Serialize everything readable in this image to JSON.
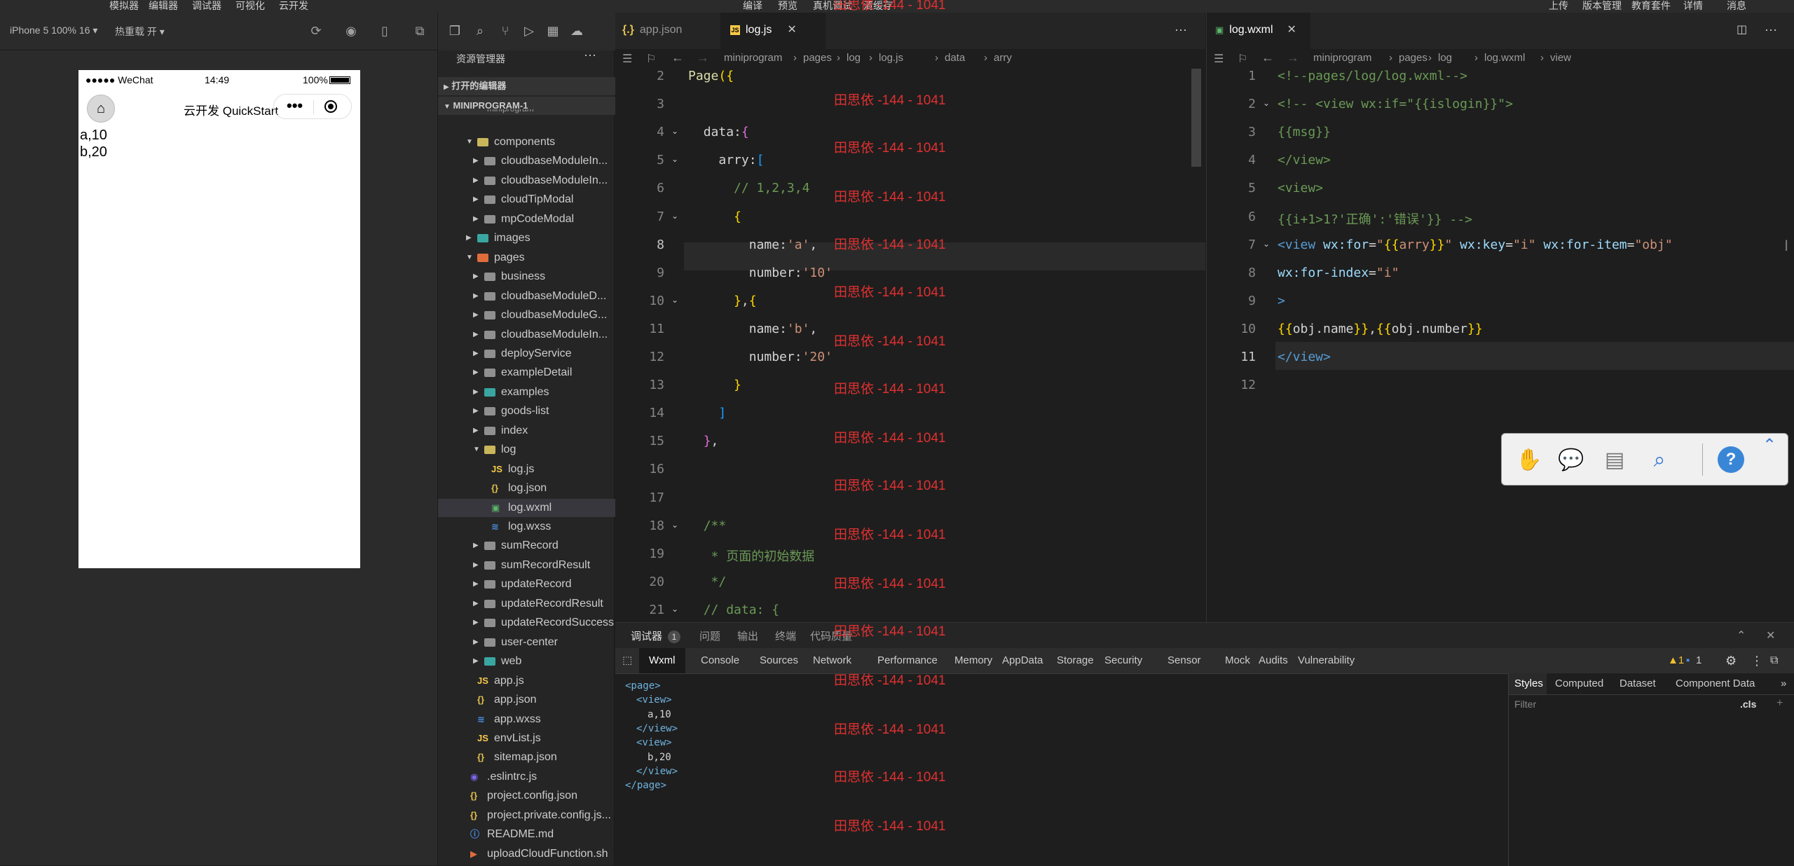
{
  "menubar": {
    "items": [
      "模拟器",
      "编辑器",
      "调试器",
      "可视化",
      "云开发",
      "编译",
      "预览",
      "真机调试",
      "清缓存",
      "上传",
      "版本管理",
      "教育套件",
      "详情",
      "消息"
    ]
  },
  "simulator": {
    "device": "iPhone 5 100% 16",
    "hot_reload": "热重载 开",
    "status": {
      "carrier": "●●●●● WeChat",
      "time": "14:49",
      "battery": "100%"
    },
    "nav_title": "云开发 QuickStart",
    "lines": [
      "a,10",
      "b,20"
    ]
  },
  "explorer": {
    "title": "资源管理器",
    "open_editors": "打开的编辑器",
    "project": "MINIPROGRAM-1",
    "partial": "miniprogram",
    "tree": [
      {
        "label": "components",
        "type": "folder",
        "open": true
      },
      {
        "label": "cloudbaseModuleIn...",
        "type": "folder"
      },
      {
        "label": "cloudbaseModuleIn...",
        "type": "folder"
      },
      {
        "label": "cloudTipModal",
        "type": "folder"
      },
      {
        "label": "mpCodeModal",
        "type": "folder"
      },
      {
        "label": "images",
        "type": "folder"
      },
      {
        "label": "pages",
        "type": "folder",
        "open": true
      },
      {
        "label": "business",
        "type": "folder"
      },
      {
        "label": "cloudbaseModuleD...",
        "type": "folder"
      },
      {
        "label": "cloudbaseModuleG...",
        "type": "folder"
      },
      {
        "label": "cloudbaseModuleIn...",
        "type": "folder"
      },
      {
        "label": "deployService",
        "type": "folder"
      },
      {
        "label": "exampleDetail",
        "type": "folder"
      },
      {
        "label": "examples",
        "type": "folder"
      },
      {
        "label": "goods-list",
        "type": "folder"
      },
      {
        "label": "index",
        "type": "folder"
      },
      {
        "label": "log",
        "type": "folder",
        "open": true
      },
      {
        "label": "log.js",
        "type": "js"
      },
      {
        "label": "log.json",
        "type": "json"
      },
      {
        "label": "log.wxml",
        "type": "wxml",
        "selected": true
      },
      {
        "label": "log.wxss",
        "type": "wxss"
      },
      {
        "label": "sumRecord",
        "type": "folder"
      },
      {
        "label": "sumRecordResult",
        "type": "folder"
      },
      {
        "label": "updateRecord",
        "type": "folder"
      },
      {
        "label": "updateRecordResult",
        "type": "folder"
      },
      {
        "label": "updateRecordSuccess",
        "type": "folder"
      },
      {
        "label": "user-center",
        "type": "folder"
      },
      {
        "label": "web",
        "type": "folder"
      },
      {
        "label": "app.js",
        "type": "js"
      },
      {
        "label": "app.json",
        "type": "json"
      },
      {
        "label": "app.wxss",
        "type": "wxss"
      },
      {
        "label": "envList.js",
        "type": "js"
      },
      {
        "label": "sitemap.json",
        "type": "json"
      },
      {
        "label": ".eslintrc.js",
        "type": "eslint"
      },
      {
        "label": "project.config.json",
        "type": "json"
      },
      {
        "label": "project.private.config.js...",
        "type": "json"
      },
      {
        "label": "README.md",
        "type": "md"
      },
      {
        "label": "uploadCloudFunction.sh",
        "type": "sh"
      }
    ]
  },
  "editor1": {
    "tabs": [
      {
        "label": "app.json"
      },
      {
        "label": "log.js",
        "active": true
      }
    ],
    "more": "···",
    "breadcrumb": [
      "miniprogram",
      "pages",
      "log",
      "log.js",
      "data",
      "arry"
    ],
    "lines": [
      {
        "n": "2",
        "html": "<span class='kw'>Page</span><span class='br1'>({</span>"
      },
      {
        "n": "3",
        "html": ""
      },
      {
        "n": "4",
        "html": "  <span class='prop'>data</span>:<span class='br2'>{</span>"
      },
      {
        "n": "5",
        "html": "    <span class='prop'>arry</span>:<span class='br3'>[</span>"
      },
      {
        "n": "6",
        "html": "      <span class='cm'>// 1,2,3,4</span>"
      },
      {
        "n": "7",
        "html": "      <span class='br1'>{</span>"
      },
      {
        "n": "8",
        "html": "        <span class='prop'>name</span>:<span class='str'>'a'</span>,"
      },
      {
        "n": "9",
        "html": "        <span class='prop'>number</span>:<span class='str'>'10'</span>"
      },
      {
        "n": "10",
        "html": "      <span class='br1'>}</span>,<span class='br1'>{</span>"
      },
      {
        "n": "11",
        "html": "        <span class='prop'>name</span>:<span class='str'>'b'</span>,"
      },
      {
        "n": "12",
        "html": "        <span class='prop'>number</span>:<span class='str'>'20'</span>"
      },
      {
        "n": "13",
        "html": "      <span class='br1'>}</span>"
      },
      {
        "n": "14",
        "html": "    <span class='br3'>]</span>"
      },
      {
        "n": "15",
        "html": "  <span class='br2'>}</span>,"
      },
      {
        "n": "16",
        "html": ""
      },
      {
        "n": "17",
        "html": ""
      },
      {
        "n": "18",
        "html": "  <span class='cm'>/**</span>"
      },
      {
        "n": "19",
        "html": "   <span class='cm'>* 页面的初始数据</span>"
      },
      {
        "n": "20",
        "html": "   <span class='cm'>*/</span>"
      },
      {
        "n": "21",
        "html": "  <span class='cm'>// data: {</span>"
      }
    ],
    "current_line": "8"
  },
  "watermark": "田思依 -144 - 1041",
  "editor2": {
    "tab": "log.wxml",
    "breadcrumb": [
      "miniprogram",
      "pages",
      "log",
      "log.wxml",
      "view"
    ],
    "lines": [
      {
        "n": "1",
        "html": "<span class='cm'>&lt;!--pages/log/log.wxml--&gt;</span>"
      },
      {
        "n": "2",
        "html": "<span class='cm'>&lt;!-- &lt;view wx:if=\"{{islogin}}\"&gt;</span>"
      },
      {
        "n": "3",
        "html": "<span class='cm'>{{msg}}</span>"
      },
      {
        "n": "4",
        "html": "<span class='cm'>&lt;/view&gt;</span>"
      },
      {
        "n": "5",
        "html": "<span class='cm'>&lt;view&gt;</span>"
      },
      {
        "n": "6",
        "html": "<span class='cm'>{{i+1&gt;1?'正确':'错误'}} --&gt;</span>"
      },
      {
        "n": "7",
        "html": "<span class='tag'>&lt;view</span> <span class='attr'>wx:for</span>=<span class='astr'>\"<span class='br1'>{{</span>arry<span class='br1'>}}</span>\"</span> <span class='attr'>wx:key</span>=<span class='astr'>\"i\"</span> <span class='attr'>wx:for-item</span>=<span class='astr'>\"obj\"</span>"
      },
      {
        "n": "8",
        "html": "<span class='attr'>wx:for-index</span>=<span class='astr'>\"i\"</span>"
      },
      {
        "n": "9",
        "html": "<span class='tag'>&gt;</span>"
      },
      {
        "n": "10",
        "html": "<span class='br1'>{{</span>obj.name<span class='br1'>}}</span>,<span class='br1'>{{</span>obj.number<span class='br1'>}}</span>"
      },
      {
        "n": "11",
        "html": "<span class='tag'>&lt;/view&gt;</span>"
      },
      {
        "n": "12",
        "html": ""
      }
    ],
    "current_line": "11"
  },
  "debugger": {
    "top_tabs": [
      "调试器",
      "问题",
      "输出",
      "终端",
      "代码质量"
    ],
    "badge": "1",
    "tabs": [
      "Wxml",
      "Console",
      "Sources",
      "Network",
      "Performance",
      "Memory",
      "AppData",
      "Storage",
      "Security",
      "Sensor",
      "Mock",
      "Audits",
      "Vulnerability"
    ],
    "active_tab": "Wxml",
    "warnings": "▲1",
    "messages": "1",
    "wxml_lines": [
      {
        "indent": 0,
        "text": "<page>",
        "kind": "tag"
      },
      {
        "indent": 1,
        "text": "<view>",
        "kind": "tag"
      },
      {
        "indent": 2,
        "text": "a,10",
        "kind": "text"
      },
      {
        "indent": 1,
        "text": "</view>",
        "kind": "tag"
      },
      {
        "indent": 1,
        "text": "<view>",
        "kind": "tag"
      },
      {
        "indent": 2,
        "text": "b,20",
        "kind": "text"
      },
      {
        "indent": 1,
        "text": "</view>",
        "kind": "tag"
      },
      {
        "indent": 0,
        "text": "</page>",
        "kind": "tag"
      }
    ],
    "style_tabs": [
      "Styles",
      "Computed",
      "Dataset",
      "Component Data"
    ],
    "filter_placeholder": "Filter",
    "cls": ".cls"
  }
}
